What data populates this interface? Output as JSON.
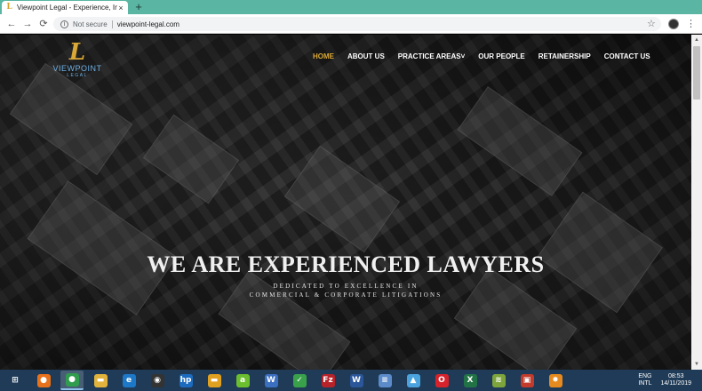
{
  "browser": {
    "tab_title": "Viewpoint Legal - Experience, Int",
    "tab_close": "×",
    "new_tab": "+",
    "back": "←",
    "forward": "→",
    "reload": "⟳",
    "security_label": "Not secure",
    "url": "viewpoint-legal.com",
    "star": "☆",
    "menu": "⋮"
  },
  "site": {
    "logo_mark": "L",
    "logo_name": "VIEWPOINT",
    "logo_sub": "LEGAL",
    "nav": [
      {
        "label": "HOME",
        "active": true
      },
      {
        "label": "ABOUT US"
      },
      {
        "label": "PRACTICE AREAS"
      },
      {
        "label": "OUR PEOPLE"
      },
      {
        "label": "RETAINERSHIP"
      },
      {
        "label": "CONTACT US"
      }
    ],
    "practice_caret": "˅",
    "hero_title": "WE ARE EXPERIENCED LAWYERS",
    "hero_sub1": "DEDICATED TO EXCELLENCE IN",
    "hero_sub2": "COMMERCIAL & CORPORATE LITIGATIONS"
  },
  "taskbar": {
    "apps": [
      {
        "name": "start",
        "glyph": "⊞",
        "color": "#1f3b57"
      },
      {
        "name": "firefox",
        "glyph": "●",
        "color": "#e8711c"
      },
      {
        "name": "chrome",
        "glyph": "●",
        "color": "#2f9c4e"
      },
      {
        "name": "file-explorer",
        "glyph": "▬",
        "color": "#e2b33c"
      },
      {
        "name": "edge",
        "glyph": "e",
        "color": "#1e78c8"
      },
      {
        "name": "camera",
        "glyph": "◉",
        "color": "#333333"
      },
      {
        "name": "hp",
        "glyph": "hp",
        "color": "#1c6bbf"
      },
      {
        "name": "folder",
        "glyph": "▬",
        "color": "#e0a020"
      },
      {
        "name": "app-green",
        "glyph": "a",
        "color": "#6bbf2e"
      },
      {
        "name": "word-doc",
        "glyph": "W",
        "color": "#3b6fbf"
      },
      {
        "name": "green-check",
        "glyph": "✓",
        "color": "#3aa14b"
      },
      {
        "name": "filezilla",
        "glyph": "Fz",
        "color": "#b8232a"
      },
      {
        "name": "word",
        "glyph": "W",
        "color": "#2b579a"
      },
      {
        "name": "notepad",
        "glyph": "≡",
        "color": "#5b8bc9"
      },
      {
        "name": "photos",
        "glyph": "▲",
        "color": "#4aa3df"
      },
      {
        "name": "opera",
        "glyph": "O",
        "color": "#d7222c"
      },
      {
        "name": "excel",
        "glyph": "X",
        "color": "#217346"
      },
      {
        "name": "spreadsheet",
        "glyph": "≋",
        "color": "#7ea53b"
      },
      {
        "name": "red-app",
        "glyph": "▣",
        "color": "#c23b2b"
      },
      {
        "name": "settings",
        "glyph": "✸",
        "color": "#e58a1e"
      }
    ],
    "tray_lang1": "ENG",
    "tray_lang2": "INTL",
    "time": "08:53",
    "date": "14/11/2019"
  }
}
